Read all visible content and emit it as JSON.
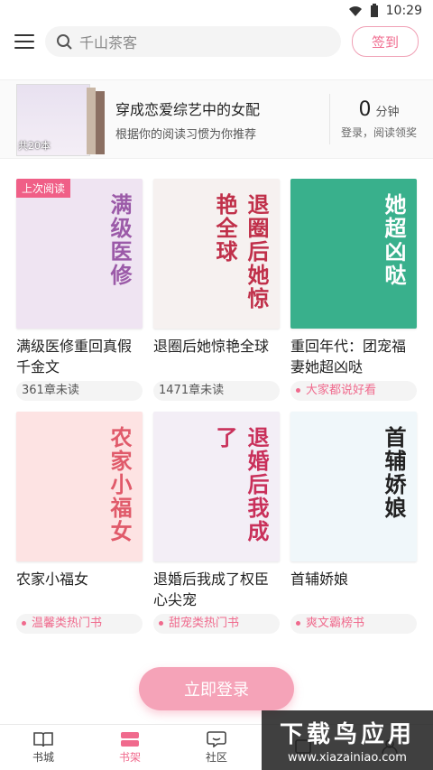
{
  "status": {
    "time": "10:29"
  },
  "search": {
    "placeholder": "千山茶客",
    "signin": "签到"
  },
  "banner": {
    "stack_label": "共20本",
    "title": "穿成恋爱综艺中的女配",
    "subtitle": "根据你的阅读习惯为你推荐",
    "minutes_value": "0",
    "minutes_unit": "分钟",
    "minutes_hint": "登录，阅读领奖"
  },
  "books": [
    {
      "title": "满级医修重回真假千金文",
      "badge": "361章未读",
      "badge_type": "plain",
      "tag": "上次阅读",
      "cover_text": "满级医修",
      "cover_bg": "#efe4f2",
      "cover_color": "#9b5aa8"
    },
    {
      "title": "退圈后她惊艳全球",
      "badge": "1471章未读",
      "badge_type": "plain",
      "tag": "",
      "cover_text": "退圈后她惊艳全球",
      "cover_bg": "#f6f1f0",
      "cover_color": "#c0304a"
    },
    {
      "title": "重回年代：团宠福妻她超凶哒",
      "badge": "大家都说好看",
      "badge_type": "pink",
      "tag": "",
      "cover_text": "她超凶哒",
      "cover_bg": "#39b08c",
      "cover_color": "#ffffff"
    },
    {
      "title": "农家小福女",
      "badge": "温馨类热门书",
      "badge_type": "pink",
      "tag": "",
      "cover_text": "农家小福女",
      "cover_bg": "#fde3e3",
      "cover_color": "#e05a6a"
    },
    {
      "title": "退婚后我成了权臣心尖宠",
      "badge": "甜宠类热门书",
      "badge_type": "pink",
      "tag": "",
      "cover_text": "退婚后我成了",
      "cover_bg": "#f3eef6",
      "cover_color": "#c9305a"
    },
    {
      "title": "首辅娇娘",
      "badge": "爽文霸榜书",
      "badge_type": "pink",
      "tag": "",
      "cover_text": "首辅娇娘",
      "cover_bg": "#f0f7fa",
      "cover_color": "#222222"
    }
  ],
  "login": "立即登录",
  "tabs": [
    {
      "label": "书城",
      "icon": "book-open-icon"
    },
    {
      "label": "书架",
      "icon": "bookshelf-icon"
    },
    {
      "label": "社区",
      "icon": "chat-icon"
    },
    {
      "label": "",
      "icon": "tab-4-icon"
    },
    {
      "label": "",
      "icon": "tab-5-icon"
    }
  ],
  "watermark": {
    "line1": "下载鸟应用",
    "line2": "www.xiazainiao.com"
  }
}
